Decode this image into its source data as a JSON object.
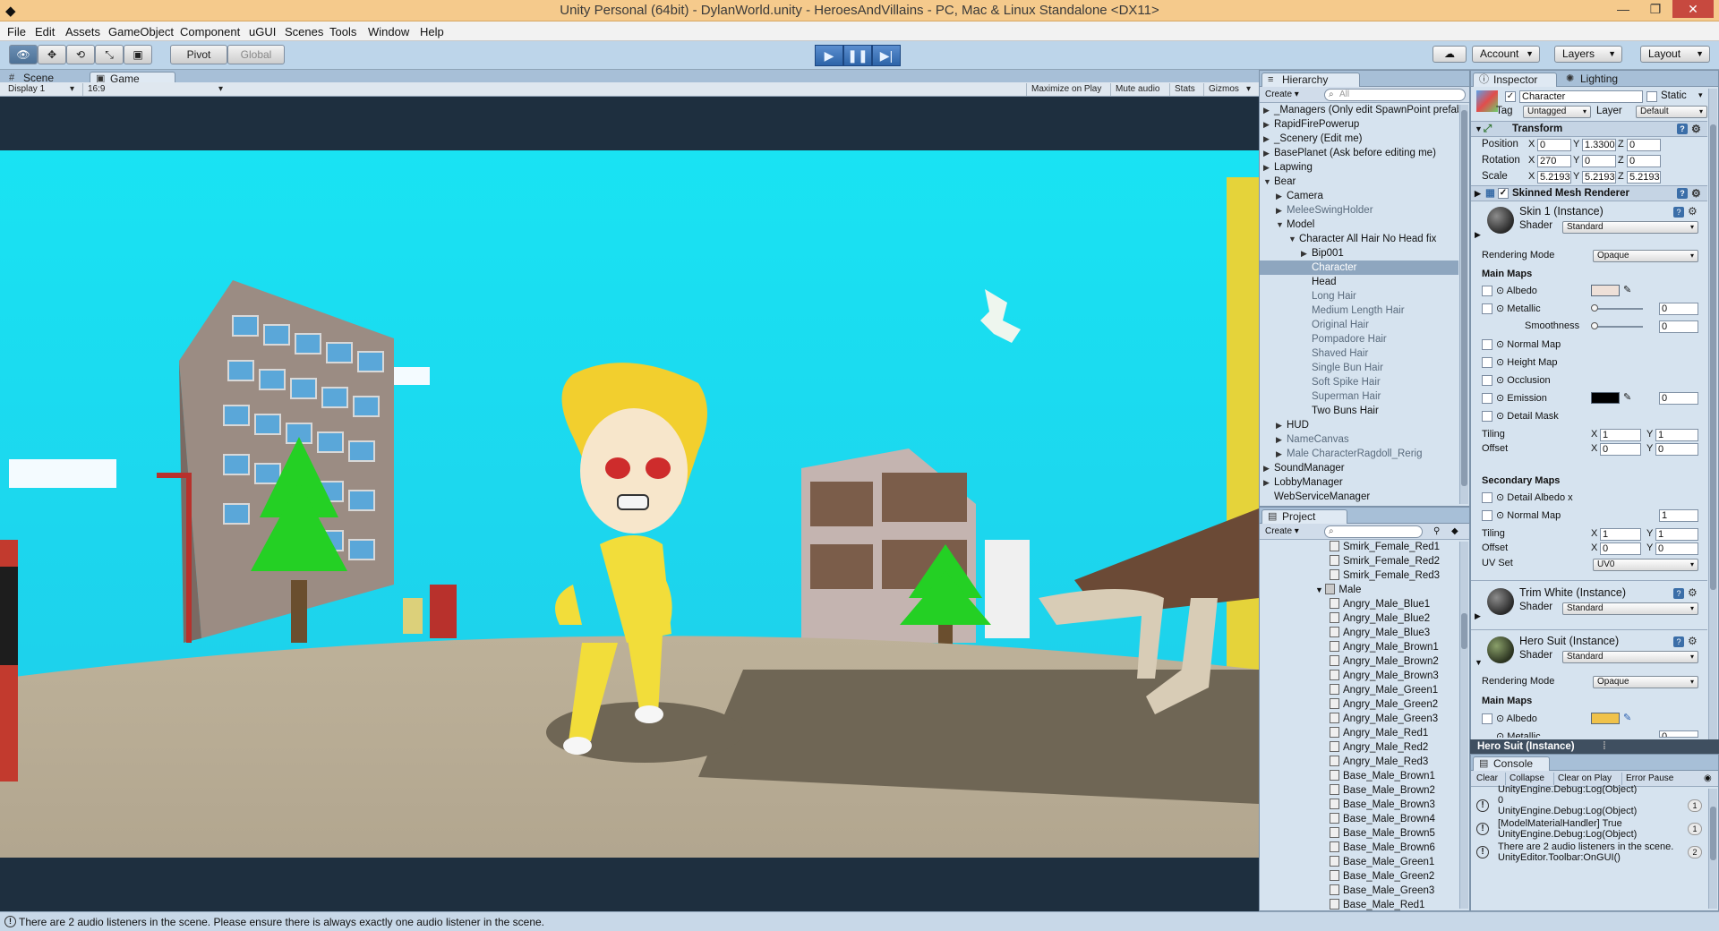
{
  "window": {
    "title": "Unity Personal (64bit) - DylanWorld.unity - HeroesAndVillains - PC, Mac & Linux Standalone <DX11>",
    "minimize": "—",
    "maximize": "❐",
    "close": "✕"
  },
  "menu": [
    "File",
    "Edit",
    "Assets",
    "GameObject",
    "Component",
    "uGUI",
    "Scenes",
    "Tools",
    "Window",
    "Help"
  ],
  "toolbar": {
    "tools": [
      "hand-icon",
      "move-icon",
      "rotate-icon",
      "scale-icon",
      "rect-icon"
    ],
    "pivot": "Pivot",
    "global": "Global",
    "account": "Account",
    "layers": "Layers",
    "layout": "Layout"
  },
  "scene_tabs": {
    "scene": "Scene",
    "game": "Game"
  },
  "gamebar": {
    "display": "Display 1",
    "aspect": "16:9",
    "maximize_on_play": "Maximize on Play",
    "mute_audio": "Mute audio",
    "stats": "Stats",
    "gizmos": "Gizmos"
  },
  "hierarchy": {
    "tab": "Hierarchy",
    "create": "Create",
    "search_placeholder": "All",
    "rows": [
      {
        "label": "_Managers (Only edit SpawnPoint prefabs)",
        "indent": 0,
        "caret": "▶",
        "state": "normal"
      },
      {
        "label": "RapidFirePowerup",
        "indent": 0,
        "caret": "▶",
        "state": "normal"
      },
      {
        "label": "_Scenery (Edit me)",
        "indent": 0,
        "caret": "▶",
        "state": "normal"
      },
      {
        "label": "BasePlanet (Ask before editing me)",
        "indent": 0,
        "caret": "▶",
        "state": "normal"
      },
      {
        "label": "Lapwing",
        "indent": 0,
        "caret": "▶",
        "state": "normal"
      },
      {
        "label": "Bear",
        "indent": 0,
        "caret": "▼",
        "state": "normal"
      },
      {
        "label": "Camera",
        "indent": 1,
        "caret": "▶",
        "state": "normal"
      },
      {
        "label": "MeleeSwingHolder",
        "indent": 1,
        "caret": "▶",
        "state": "dim"
      },
      {
        "label": "Model",
        "indent": 1,
        "caret": "▼",
        "state": "normal"
      },
      {
        "label": "Character All Hair No Head fix",
        "indent": 2,
        "caret": "▼",
        "state": "normal"
      },
      {
        "label": "Bip001",
        "indent": 3,
        "caret": "▶",
        "state": "normal"
      },
      {
        "label": "Character",
        "indent": 3,
        "caret": "",
        "state": "selected"
      },
      {
        "label": "Head",
        "indent": 3,
        "caret": "",
        "state": "normal"
      },
      {
        "label": "Long Hair",
        "indent": 3,
        "caret": "",
        "state": "dim"
      },
      {
        "label": "Medium Length Hair",
        "indent": 3,
        "caret": "",
        "state": "dim"
      },
      {
        "label": "Original Hair",
        "indent": 3,
        "caret": "",
        "state": "dim"
      },
      {
        "label": "Pompadore Hair",
        "indent": 3,
        "caret": "",
        "state": "dim"
      },
      {
        "label": "Shaved Hair",
        "indent": 3,
        "caret": "",
        "state": "dim"
      },
      {
        "label": "Single Bun Hair",
        "indent": 3,
        "caret": "",
        "state": "dim"
      },
      {
        "label": "Soft Spike Hair",
        "indent": 3,
        "caret": "",
        "state": "dim"
      },
      {
        "label": "Superman Hair",
        "indent": 3,
        "caret": "",
        "state": "dim"
      },
      {
        "label": "Two Buns Hair",
        "indent": 3,
        "caret": "",
        "state": "normal"
      },
      {
        "label": "HUD",
        "indent": 1,
        "caret": "▶",
        "state": "normal"
      },
      {
        "label": "NameCanvas",
        "indent": 1,
        "caret": "▶",
        "state": "dim"
      },
      {
        "label": "Male CharacterRagdoll_Rerig",
        "indent": 1,
        "caret": "▶",
        "state": "dim"
      },
      {
        "label": "SoundManager",
        "indent": 0,
        "caret": "▶",
        "state": "normal"
      },
      {
        "label": "LobbyManager",
        "indent": 0,
        "caret": "▶",
        "state": "normal"
      },
      {
        "label": "WebServiceManager",
        "indent": 0,
        "caret": "",
        "state": "normal"
      }
    ]
  },
  "project": {
    "tab": "Project",
    "create": "Create",
    "rows": [
      {
        "label": "Smirk_Female_Red1",
        "folder": false
      },
      {
        "label": "Smirk_Female_Red2",
        "folder": false
      },
      {
        "label": "Smirk_Female_Red3",
        "folder": false
      },
      {
        "label": "Male",
        "folder": true
      },
      {
        "label": "Angry_Male_Blue1",
        "folder": false
      },
      {
        "label": "Angry_Male_Blue2",
        "folder": false
      },
      {
        "label": "Angry_Male_Blue3",
        "folder": false
      },
      {
        "label": "Angry_Male_Brown1",
        "folder": false
      },
      {
        "label": "Angry_Male_Brown2",
        "folder": false
      },
      {
        "label": "Angry_Male_Brown3",
        "folder": false
      },
      {
        "label": "Angry_Male_Green1",
        "folder": false
      },
      {
        "label": "Angry_Male_Green2",
        "folder": false
      },
      {
        "label": "Angry_Male_Green3",
        "folder": false
      },
      {
        "label": "Angry_Male_Red1",
        "folder": false
      },
      {
        "label": "Angry_Male_Red2",
        "folder": false
      },
      {
        "label": "Angry_Male_Red3",
        "folder": false
      },
      {
        "label": "Base_Male_Brown1",
        "folder": false
      },
      {
        "label": "Base_Male_Brown2",
        "folder": false
      },
      {
        "label": "Base_Male_Brown3",
        "folder": false
      },
      {
        "label": "Base_Male_Brown4",
        "folder": false
      },
      {
        "label": "Base_Male_Brown5",
        "folder": false
      },
      {
        "label": "Base_Male_Brown6",
        "folder": false
      },
      {
        "label": "Base_Male_Green1",
        "folder": false
      },
      {
        "label": "Base_Male_Green2",
        "folder": false
      },
      {
        "label": "Base_Male_Green3",
        "folder": false
      },
      {
        "label": "Base_Male_Red1",
        "folder": false
      }
    ]
  },
  "inspector": {
    "tab": "Inspector",
    "lighting_tab": "Lighting",
    "object_name": "Character",
    "static_label": "Static",
    "tag_label": "Tag",
    "tag_value": "Untagged",
    "layer_label": "Layer",
    "layer_value": "Default",
    "transform": {
      "title": "Transform",
      "position_label": "Position",
      "rotation_label": "Rotation",
      "scale_label": "Scale",
      "position": [
        "0",
        "1.3300",
        "0"
      ],
      "rotation": [
        "270",
        "0",
        "0"
      ],
      "scale": [
        "5.2193",
        "5.2193",
        "5.2193"
      ]
    },
    "smr_title": "Skinned Mesh Renderer",
    "shader_label": "Shader",
    "shader_value": "Standard",
    "rendering_mode_label": "Rendering Mode",
    "rendering_mode_value": "Opaque",
    "main_maps": "Main Maps",
    "albedo": "Albedo",
    "metallic": "Metallic",
    "smoothness": "Smoothness",
    "normal_map": "Normal Map",
    "height_map": "Height Map",
    "occlusion": "Occlusion",
    "emission": "Emission",
    "detail_mask": "Detail Mask",
    "tiling": "Tiling",
    "offset": "Offset",
    "secondary_maps": "Secondary Maps",
    "detail_albedo": "Detail Albedo x",
    "uv_set": "UV Set",
    "uv_value": "UV0",
    "mat1": {
      "name": "Skin 1 (Instance)",
      "albedo_color": "#eee0d8",
      "metallic": "0",
      "smoothness": "0",
      "emission_color": "#000000",
      "emission": "0",
      "tiling": [
        "1",
        "1"
      ],
      "offset": [
        "0",
        "0"
      ],
      "normal_scale": "1",
      "tiling2": [
        "1",
        "1"
      ],
      "offset2": [
        "0",
        "0"
      ]
    },
    "mat2": {
      "name": "Trim White (Instance)"
    },
    "mat3": {
      "name": "Hero Suit (Instance)",
      "albedo_color": "#f0c24a",
      "metallic_value": "0"
    },
    "preview_label": "Hero Suit (Instance)"
  },
  "console": {
    "tab": "Console",
    "buttons": [
      "Clear",
      "Collapse",
      "Clear on Play",
      "Error Pause"
    ],
    "partial_top": "UnityEngine.Debug:Log(Object)",
    "rows": [
      {
        "line1": "0",
        "line2": "UnityEngine.Debug:Log(Object)",
        "count": "1"
      },
      {
        "line1": "[ModelMaterialHandler] True",
        "line2": "UnityEngine.Debug:Log(Object)",
        "count": "1"
      },
      {
        "line1": "There are 2 audio listeners in the scene.",
        "line2": "UnityEditor.Toolbar:OnGUI()",
        "count": "2"
      }
    ]
  },
  "status": {
    "text": "There are 2 audio listeners in the scene. Please ensure there is always exactly one audio listener in the scene."
  }
}
